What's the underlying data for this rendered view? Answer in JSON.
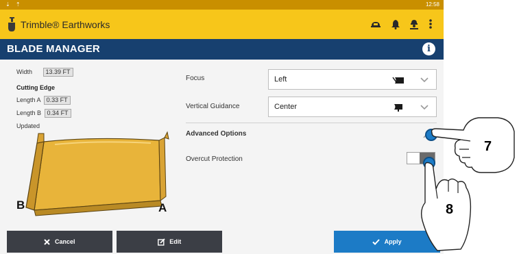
{
  "status_bar": {
    "left_icons": "⇣ ⇡",
    "time": "12:58"
  },
  "app": {
    "title": "Trimble® Earthworks",
    "icons": [
      "vehicle-icon",
      "bell-icon",
      "operator-icon",
      "more-vert-icon"
    ]
  },
  "page": {
    "title": "BLADE MANAGER"
  },
  "blade_info": {
    "width_label": "Width",
    "width_value": "13.39 FT",
    "cutting_edge_label": "Cutting Edge",
    "length_a_label": "Length A",
    "length_a_value": "0.33 FT",
    "length_b_label": "Length B",
    "length_b_value": "0.34 FT",
    "updated_label": "Updated",
    "side_b": "B",
    "side_a": "A",
    "blade_color": "#e8b43a"
  },
  "settings": {
    "focus_label": "Focus",
    "focus_value": "Left",
    "vertical_label": "Vertical Guidance",
    "vertical_value": "Center",
    "advanced_label": "Advanced Options",
    "overcut_label": "Overcut Protection"
  },
  "actions": {
    "cancel": "Cancel",
    "edit": "Edit",
    "apply": "Apply"
  },
  "annotations": {
    "step_a": "7",
    "step_b": "8"
  },
  "colors": {
    "status": "#c98f00",
    "appbar": "#f7c61a",
    "titlebar": "#17406f",
    "apply": "#1c7bc6",
    "dark_button": "#3b3e45"
  }
}
